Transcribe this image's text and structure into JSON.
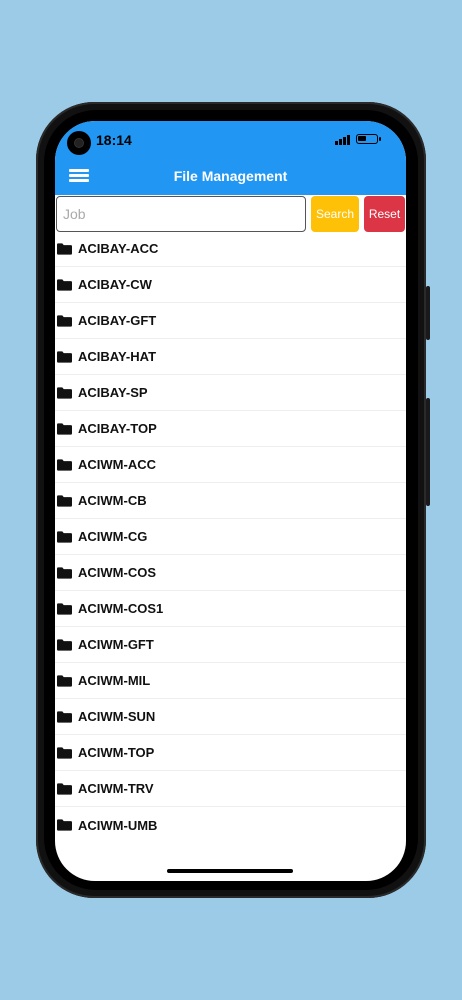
{
  "status_bar": {
    "time": "18:14"
  },
  "header": {
    "title": "File Management",
    "background_color": "#2196f3"
  },
  "search": {
    "value": "",
    "placeholder": "Job",
    "search_label": "Search",
    "reset_label": "Reset",
    "search_color": "#ffc107",
    "reset_color": "#dc3545"
  },
  "folders": [
    {
      "name": "ACIBAY-ACC",
      "icon": "folder-icon"
    },
    {
      "name": "ACIBAY-CW",
      "icon": "folder-icon"
    },
    {
      "name": "ACIBAY-GFT",
      "icon": "folder-icon"
    },
    {
      "name": "ACIBAY-HAT",
      "icon": "folder-icon"
    },
    {
      "name": "ACIBAY-SP",
      "icon": "folder-icon"
    },
    {
      "name": "ACIBAY-TOP",
      "icon": "folder-icon"
    },
    {
      "name": "ACIWM-ACC",
      "icon": "folder-icon"
    },
    {
      "name": "ACIWM-CB",
      "icon": "folder-icon"
    },
    {
      "name": "ACIWM-CG",
      "icon": "folder-icon"
    },
    {
      "name": "ACIWM-COS",
      "icon": "folder-icon"
    },
    {
      "name": "ACIWM-COS1",
      "icon": "folder-icon"
    },
    {
      "name": "ACIWM-GFT",
      "icon": "folder-icon"
    },
    {
      "name": "ACIWM-MIL",
      "icon": "folder-icon"
    },
    {
      "name": "ACIWM-SUN",
      "icon": "folder-icon"
    },
    {
      "name": "ACIWM-TOP",
      "icon": "folder-icon"
    },
    {
      "name": "ACIWM-TRV",
      "icon": "folder-icon"
    },
    {
      "name": "ACIWM-UMB",
      "icon": "folder-icon"
    }
  ]
}
